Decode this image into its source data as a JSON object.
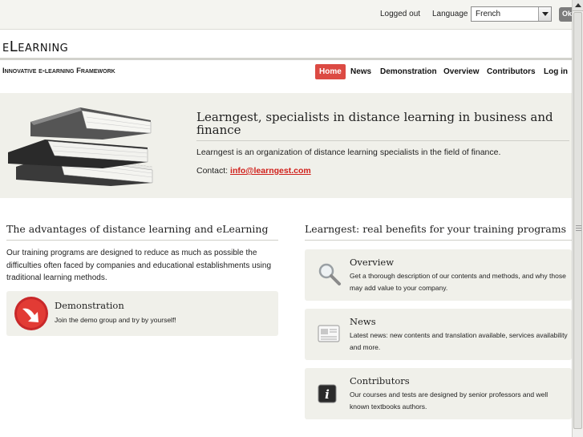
{
  "topbar": {
    "logged_out": "Logged out",
    "language_label": "Language",
    "language_value": "French",
    "ok_label": "Ok"
  },
  "header": {
    "site_title": "eLearning",
    "tagline": "Innovative e-learning Framework"
  },
  "nav": {
    "items": [
      {
        "label": "Home",
        "active": true
      },
      {
        "label": "News"
      },
      {
        "label": "Demonstration"
      },
      {
        "label": "Overview"
      },
      {
        "label": "Contributors"
      },
      {
        "label": "Log in"
      }
    ]
  },
  "hero": {
    "title": "Learngest, specialists in distance learning in business and finance",
    "text": "Learngest is an organization of distance learning specialists in the field of finance.",
    "contact_label": "Contact:",
    "contact_email": "info@learngest.com"
  },
  "left": {
    "heading": "The advantages of distance learning and eLearning",
    "text": "Our training programs are designed to reduce as much as possible the difficulties often faced by companies and educational establishments using traditional learning methods.",
    "demo": {
      "title": "Demonstration",
      "description": "Join the demo group and try by yourself!",
      "icon": "red-arrow-icon"
    }
  },
  "right": {
    "heading": "Learngest: real benefits for your training programs",
    "cards": [
      {
        "title": "Overview",
        "description": "Get a thorough description of our contents and methods, and why those may add value to your company.",
        "icon": "magnifier-icon"
      },
      {
        "title": "News",
        "description": "Latest news: new contents and translation available, services availability and more.",
        "icon": "newspaper-icon"
      },
      {
        "title": "Contributors",
        "description": "Our courses and tests are designed by senior professors and well known textbooks authors.",
        "icon": "info-icon"
      }
    ]
  },
  "colors": {
    "accent": "#dc4a43",
    "link": "#d0201b",
    "panel": "#f0f0ea"
  }
}
